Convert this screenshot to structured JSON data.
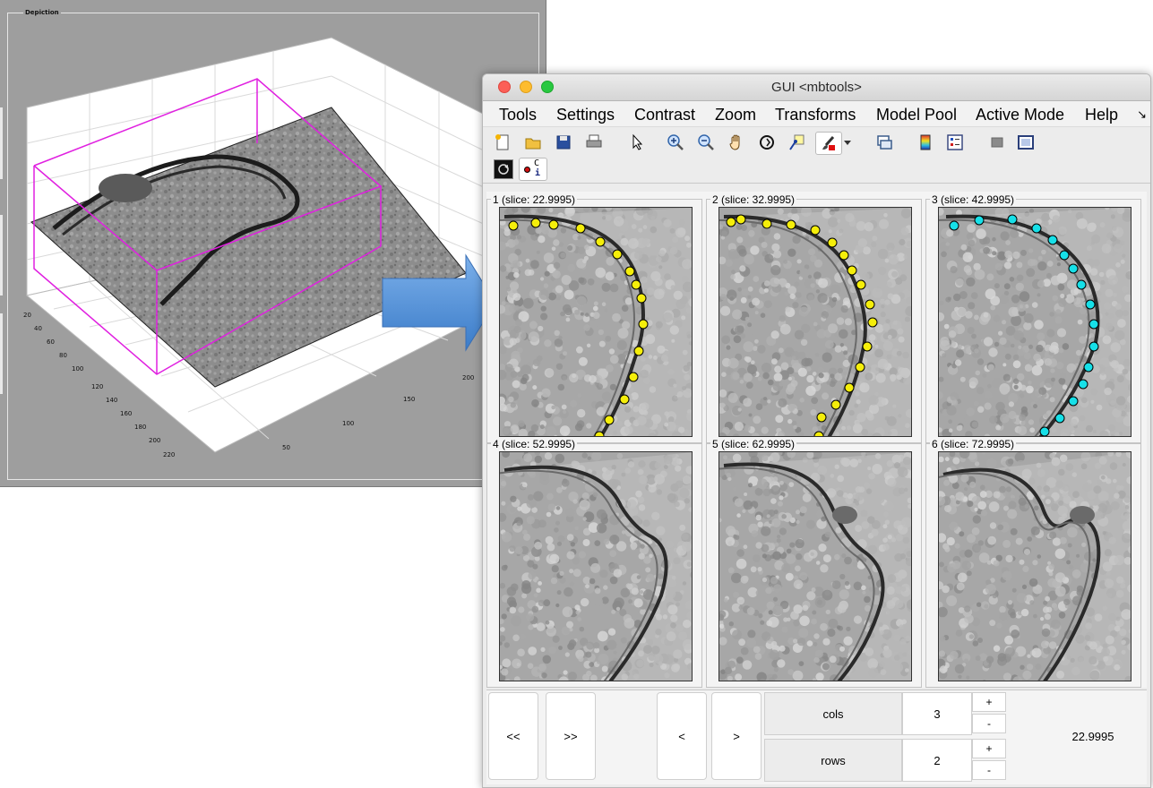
{
  "depiction": {
    "title": "Depiction",
    "y_ticks": [
      "20",
      "40",
      "60",
      "80",
      "100",
      "120",
      "140",
      "160",
      "180",
      "200",
      "220"
    ],
    "x_ticks": [
      "50",
      "100",
      "150",
      "200"
    ]
  },
  "window": {
    "title": "GUI <mbtools>"
  },
  "menu": [
    "Tools",
    "Settings",
    "Contrast",
    "Zoom",
    "Transforms",
    "Model Pool",
    "Active Mode",
    "Help"
  ],
  "menu_overflow": "↘",
  "toolbar": [
    "new-file-icon",
    "open-folder-icon",
    "save-icon",
    "print-icon",
    "pointer-icon",
    "zoom-in-icon",
    "zoom-out-icon",
    "pan-hand-icon",
    "rotate-3d-icon",
    "data-cursor-icon",
    "brush-icon",
    "dropdown-arrow-icon",
    "link-plot-icon",
    "colorbar-icon",
    "legend-icon",
    "hide-tools-icon",
    "show-tools-icon"
  ],
  "toolbar2": {
    "picker_label_c": "C",
    "picker_label_i": "i"
  },
  "panels": [
    {
      "label": "1 (slice: 22.9995)",
      "points": "yellow"
    },
    {
      "label": "2 (slice: 32.9995)",
      "points": "yellow"
    },
    {
      "label": "3 (slice: 42.9995)",
      "points": "cyan"
    },
    {
      "label": "4 (slice: 52.9995)",
      "points": "none"
    },
    {
      "label": "5 (slice: 62.9995)",
      "points": "none"
    },
    {
      "label": "6 (slice: 72.9995)",
      "points": "none"
    }
  ],
  "controls": {
    "first": "<<",
    "last": ">>",
    "prev": "<",
    "next": ">",
    "cols_label": "cols",
    "cols_value": "3",
    "rows_label": "rows",
    "rows_value": "2",
    "plus": "+",
    "minus": "-",
    "slice_value": "22.9995"
  },
  "colors": {
    "point_yellow": "#f5ee0a",
    "point_cyan": "#16e0e8",
    "magenta_box": "#e020e0",
    "arrow_blue": "#4a8fd8"
  }
}
